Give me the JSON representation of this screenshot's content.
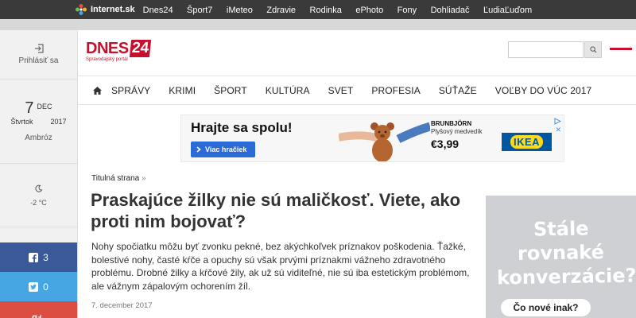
{
  "topbar": {
    "logo": "Internet.sk",
    "nav": [
      "Dnes24",
      "Šport7",
      "iMeteo",
      "Zdravie",
      "Rodinka",
      "ePhoto",
      "Fony",
      "Dohliadač",
      "ĽudiaĽuďom"
    ]
  },
  "sidebar": {
    "login": "Prihlásiť sa",
    "date_day": "7",
    "date_month": "DEC",
    "date_weekday": "Štvrtok",
    "date_year": "2017",
    "nameday": "Ambróz",
    "weather": "-2 °C",
    "facebook_count": "3",
    "twitter_count": "0"
  },
  "header": {
    "brand": "DNES",
    "brand_num": "24",
    "tagline": "Spravodajský portál",
    "search_placeholder": ""
  },
  "nav": [
    "SPRÁVY",
    "KRIMI",
    "ŠPORT",
    "KULTÚRA",
    "SVET",
    "PROFESIA",
    "SÚŤAŽE",
    "VOĽBY DO VÚC 2017"
  ],
  "ad": {
    "headline": "Hrajte sa spolu!",
    "cta": "Viac hračiek",
    "product_name": "BRUNBJÖRN",
    "product_desc": "Plyšový medvedík",
    "price": "€3,99",
    "brand": "IKEA",
    "close": "✕"
  },
  "breadcrumb": {
    "label": "Titulná strana",
    "separator": "»"
  },
  "article": {
    "title": "Praskajúce žilky nie sú maličkosť. Viete, ako proti nim bojovať?",
    "lead": "Nohy spočiatku môžu byť zvonku pekné, bez akýchkoľvek príznakov poškodenia. Ťažké, bolestivé nohy, časté kŕče a opuchy sú však prvými príznakmi vážneho zdravotného problému. Drobné žilky a kŕčové žily, ak už sú viditeľné, nie sú iba estetickým problémom, ale vážnym zápalovým ochorením žíl.",
    "date": "7. december 2017"
  },
  "side_ad": {
    "line1": "Stále",
    "line2": "rovnaké",
    "line3": "konverzácie?",
    "button": "Čo nové inak?"
  }
}
